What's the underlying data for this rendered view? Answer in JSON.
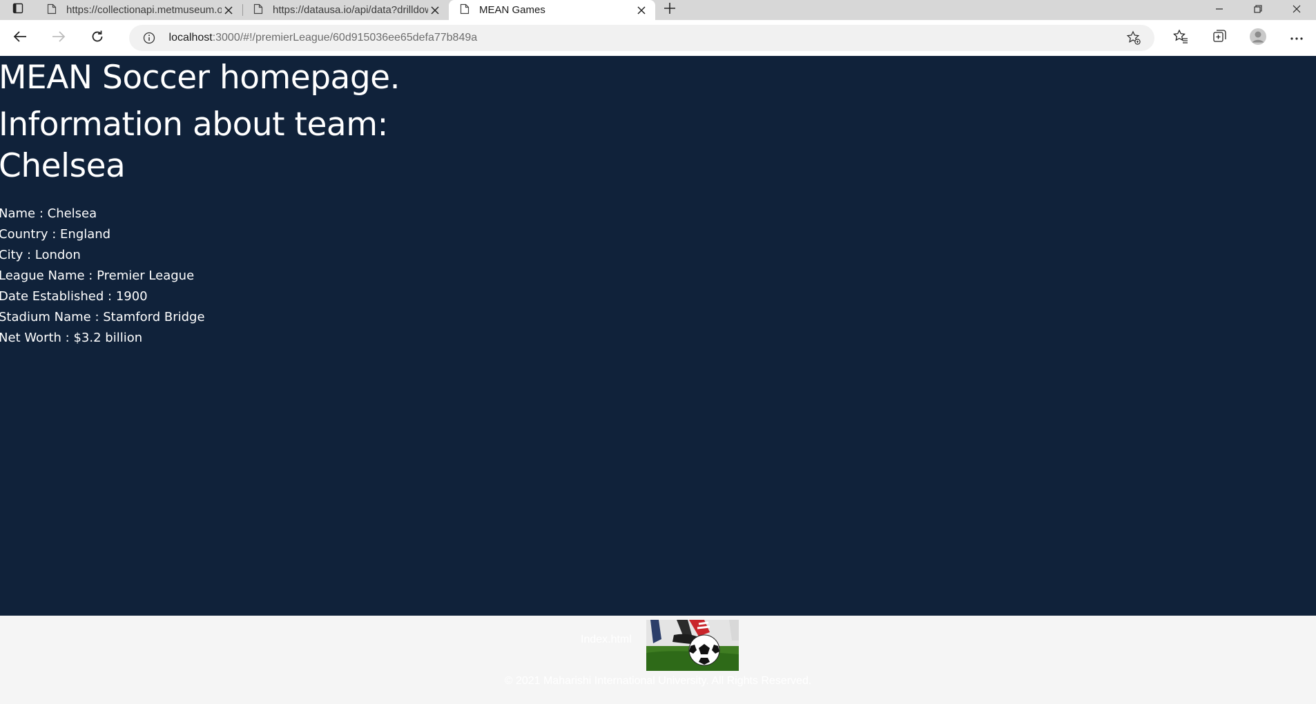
{
  "browser": {
    "tabs": [
      {
        "title": "https://collectionapi.metmuseum.org/public/collection",
        "active": false
      },
      {
        "title": "https://datausa.io/api/data?drilldowns=Nation",
        "active": false
      },
      {
        "title": "MEAN Games",
        "active": true
      }
    ],
    "url_host": "localhost",
    "url_path": ":3000/#!/premierLeague/60d915036ee65defa77b849a"
  },
  "page": {
    "heading": "MEAN Soccer homepage.",
    "subheading": "Information about team: Chelsea",
    "details": [
      {
        "label": "Name",
        "value": "Chelsea"
      },
      {
        "label": "Country",
        "value": "England"
      },
      {
        "label": "City",
        "value": "London"
      },
      {
        "label": "League Name",
        "value": "Premier League"
      },
      {
        "label": "Date Established",
        "value": "1900"
      },
      {
        "label": "Stadium Name",
        "value": "Stamford Bridge"
      },
      {
        "label": "Net Worth",
        "value": "$3.2 billion"
      }
    ]
  },
  "footer": {
    "link": "Index.html",
    "image_alt": "soccer ball",
    "copyright": "© 2021 Maharishi International University. All Rights Reserved."
  },
  "colors": {
    "page_background": "#10223a",
    "footer_background": "#f5f5f5",
    "tabstrip": "#d7d7d7"
  }
}
